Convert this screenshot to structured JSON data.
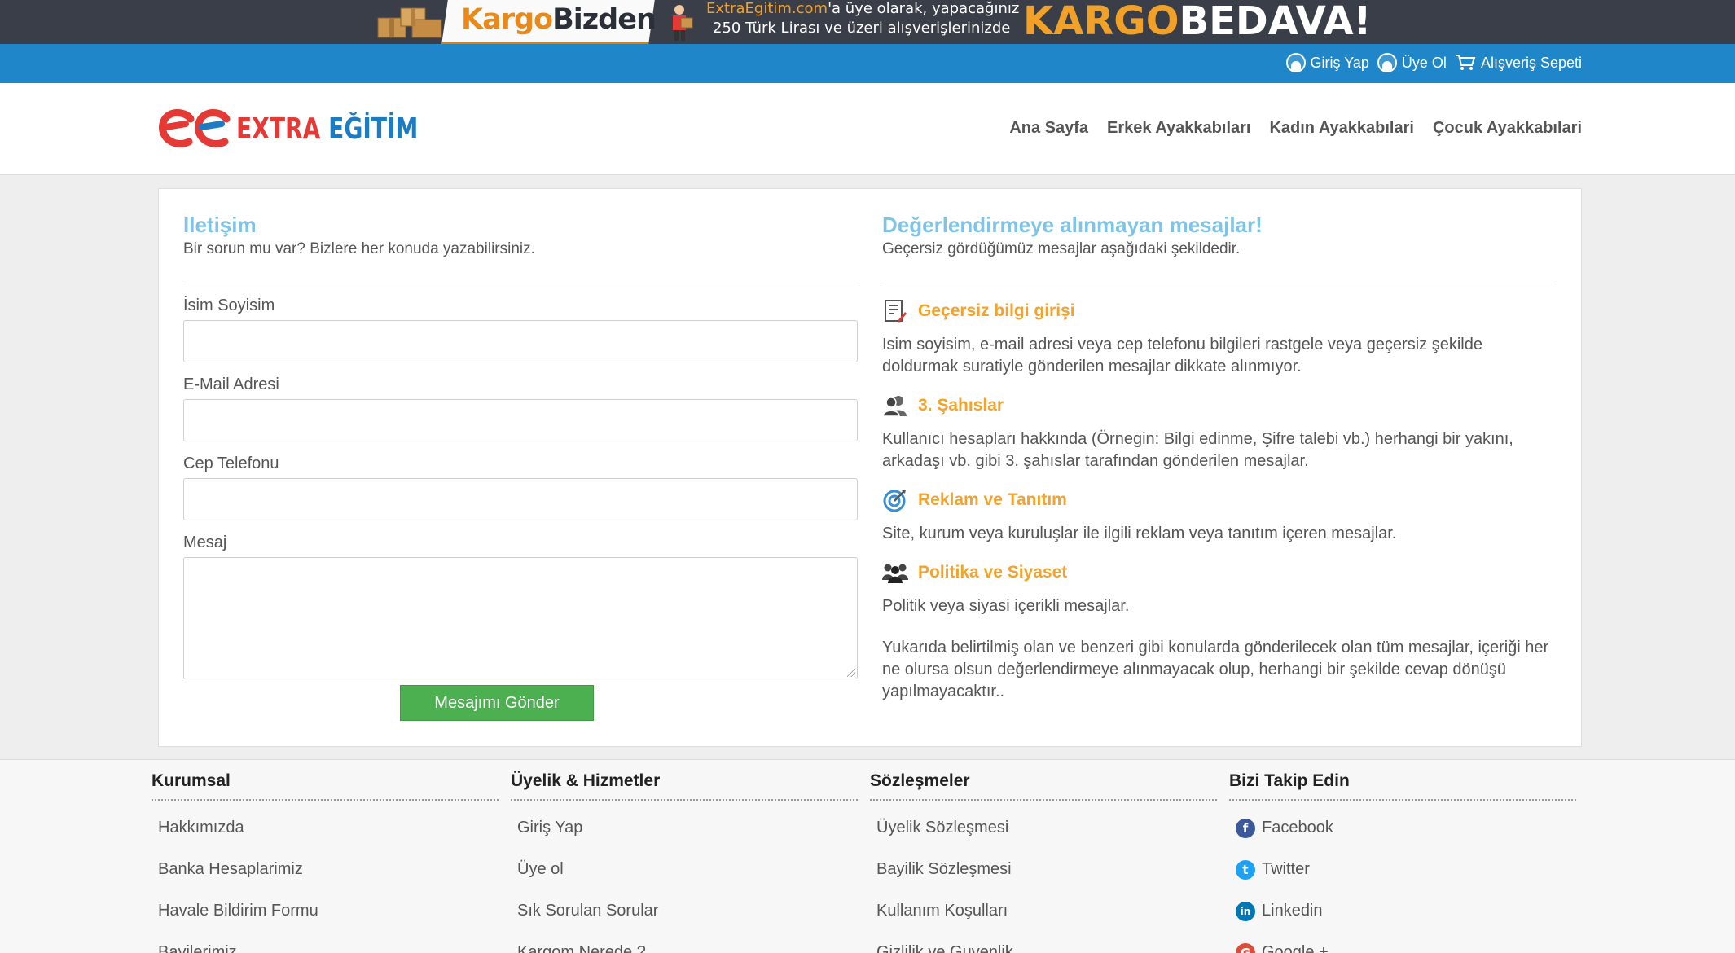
{
  "promo": {
    "kargo": "Kargo",
    "bizden": "Bizden",
    "site": "ExtraEgitim.com",
    "line1_rest": "'a üye olarak, yapacağınız",
    "line2": "250 Türk Lirası ve üzeri alışverişlerinizde",
    "big_kargo": "KARGO",
    "big_bedava": "BEDAVA!"
  },
  "userbar": {
    "login": "Giriş Yap",
    "register": "Üye Ol",
    "cart": "Alışveriş Sepeti"
  },
  "header": {
    "logo_extra": "EXTRA",
    "logo_egitim": "EĞİTİM",
    "nav": [
      "Ana Sayfa",
      "Erkek Ayakkabıları",
      "Kadın Ayakkabılari",
      "Çocuk Ayakkabılari"
    ]
  },
  "contact": {
    "title": "Iletişim",
    "subtitle": "Bir sorun mu var? Bizlere her konuda yazabilirsiniz.",
    "fields": {
      "name_label": "İsim Soyisim",
      "name_value": "",
      "email_label": "E-Mail Adresi",
      "email_value": "",
      "phone_label": "Cep Telefonu",
      "phone_value": "",
      "message_label": "Mesaj",
      "message_value": ""
    },
    "submit": "Mesajımı Gönder"
  },
  "rules": {
    "title": "Değerlendirmeye alınmayan mesajlar!",
    "subtitle": "Geçersiz gördüğümüz mesajlar aşağıdaki şekildedir.",
    "items": [
      {
        "icon": "document-edit-icon",
        "title": "Geçersiz bilgi girişi",
        "body": "Isim soyisim, e-mail adresi veya cep telefonu bilgileri rastgele veya geçersiz şekilde doldurmak suratiyle gönderilen mesajlar dikkate alınmıyor."
      },
      {
        "icon": "users-icon",
        "title": "3. Şahıslar",
        "body": "Kullanıcı hesapları hakkında (Örnegin: Bilgi edinme, Şifre talebi vb.) herhangi bir yakını, arkadaşı vb. gibi 3. şahıslar tarafından gönderilen mesajlar."
      },
      {
        "icon": "target-icon",
        "title": "Reklam ve Tanıtım",
        "body": "Site, kurum veya kuruluşlar ile ilgili reklam veya tanıtım içeren mesajlar."
      },
      {
        "icon": "group-icon",
        "title": "Politika ve Siyaset",
        "body": "Politik veya siyasi içerikli mesajlar."
      }
    ],
    "closing": "Yukarıda belirtilmiş olan ve benzeri gibi konularda gönderilecek olan tüm mesajlar, içeriği her ne olursa olsun değerlendirmeye alınmayacak olup, herhangi bir şekilde cevap dönüşü yapılmayacaktır.."
  },
  "footer": {
    "columns": [
      {
        "title": "Kurumsal",
        "items": [
          "Hakkımızda",
          "Banka Hesaplarimiz",
          "Havale Bildirim Formu",
          "Bayilerimiz"
        ]
      },
      {
        "title": "Üyelik & Hizmetler",
        "items": [
          "Giriş Yap",
          "Üye ol",
          "Sık Sorulan Sorular",
          "Kargom Nerede ?"
        ]
      },
      {
        "title": "Sözleşmeler",
        "items": [
          "Üyelik Sözleşmesi",
          "Bayilik Sözleşmesi",
          "Kullanım Koşulları",
          "Gizlilik ve Guvenlik"
        ]
      },
      {
        "title": "Bizi Takip Edin",
        "items": [
          "Facebook",
          "Twitter",
          "Linkedin",
          "Google +"
        ]
      }
    ],
    "social": [
      {
        "icon": "facebook-icon",
        "color": "#3b5998",
        "glyph": "f"
      },
      {
        "icon": "twitter-icon",
        "color": "#1da1f2",
        "glyph": "t"
      },
      {
        "icon": "linkedin-icon",
        "color": "#0077b5",
        "glyph": "in"
      },
      {
        "icon": "google-plus-icon",
        "color": "#dd4b39",
        "glyph": "G"
      }
    ]
  },
  "colors": {
    "userbar": "#1f86c9",
    "accent_orange": "#f5a22a",
    "title_blue": "#7fc4e6",
    "button_green": "#4caf50"
  }
}
